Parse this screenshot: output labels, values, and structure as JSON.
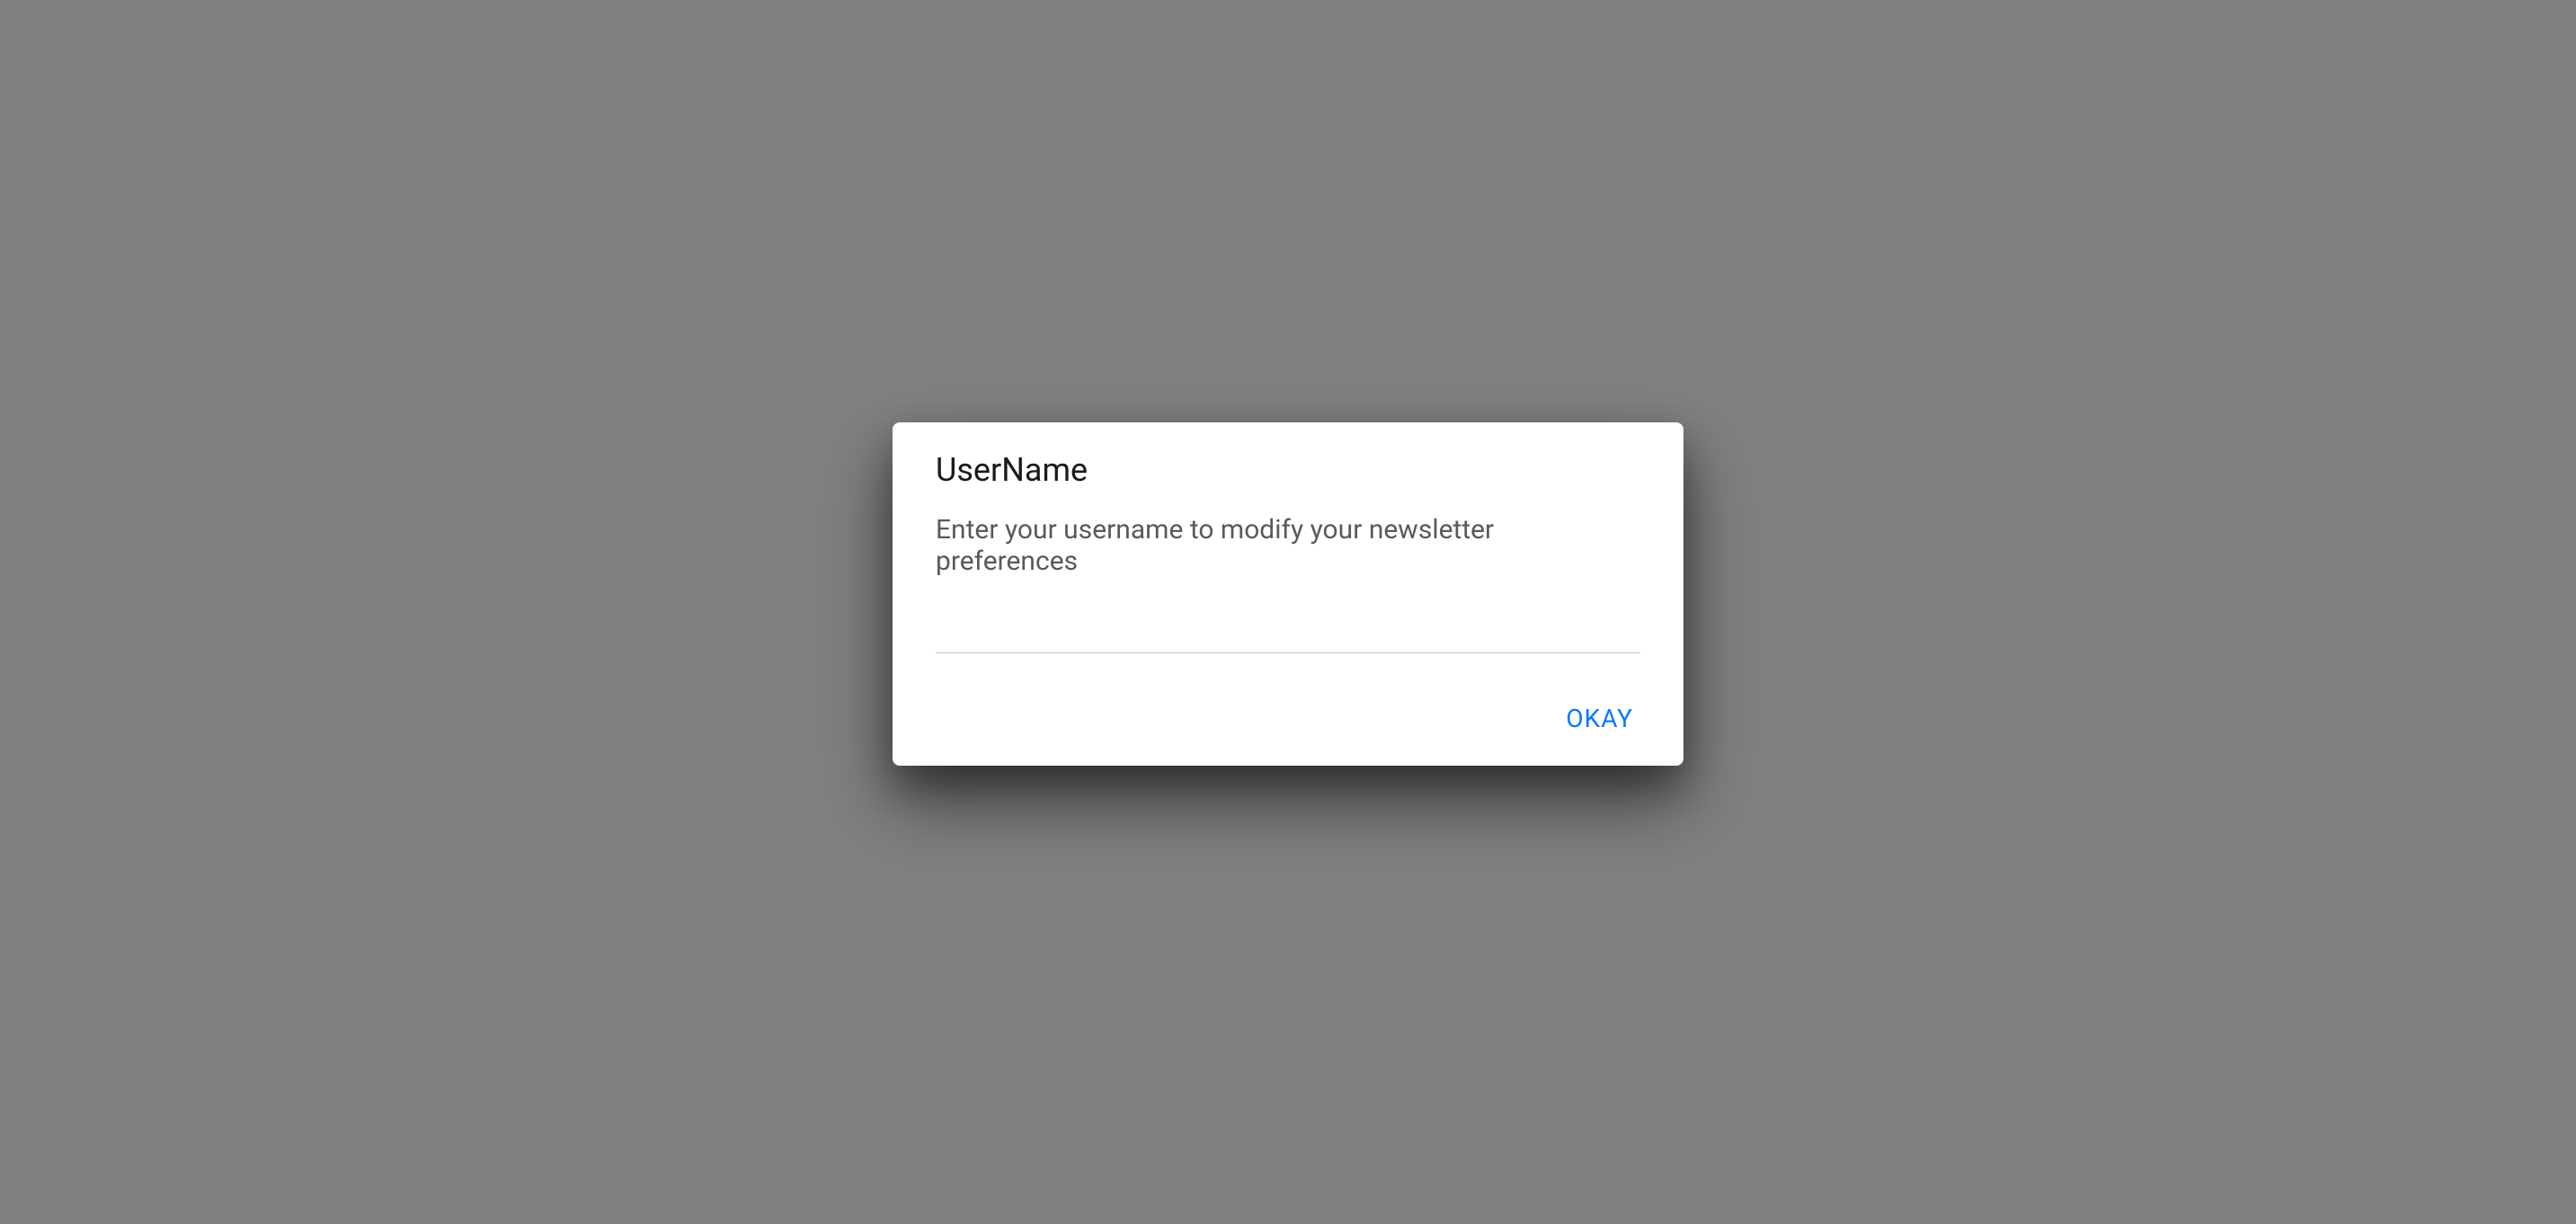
{
  "dialog": {
    "title": "UserName",
    "description": "Enter your username to modify your newsletter preferences",
    "input_value": "",
    "input_placeholder": "",
    "okay_label": "OKAY"
  },
  "colors": {
    "accent": "#0a7aff",
    "backdrop": "#808080",
    "dialog_bg": "#ffffff",
    "title_text": "#1a1a1a",
    "description_text": "#5a5a5a",
    "input_border": "#bdbdbd"
  }
}
